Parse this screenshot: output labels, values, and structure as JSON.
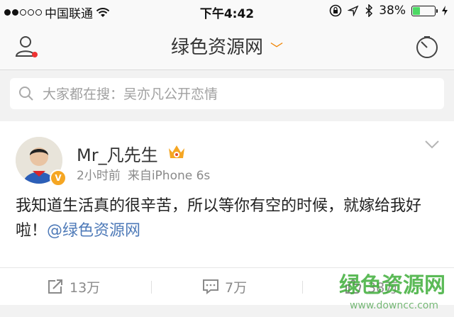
{
  "status_bar": {
    "carrier": "中国联通",
    "time": "下午4:42",
    "battery_percent": "38%",
    "battery_level": 0.38
  },
  "nav": {
    "title": "绿色资源网",
    "title_chevron": "﹀"
  },
  "search": {
    "placeholder": "大家都在搜：吴亦凡公开恋情"
  },
  "post": {
    "author": "Mr_凡先生",
    "time": "2小时前",
    "source": "来自iPhone 6s",
    "verified_badge": "V",
    "text": "我知道生活真的很辛苦，所以等你有空的时候，就嫁给我好啦！",
    "mention": "@绿色资源网"
  },
  "actions": {
    "repost_count": "13万",
    "comment_count": "7万",
    "like_count": "38万"
  },
  "watermark": {
    "text": "绿色资源网",
    "url": "www.downcc.com"
  },
  "colors": {
    "accent_orange": "#f08300",
    "link_blue": "#4e7ab8",
    "notification_red": "#e33",
    "battery_green": "#4cd964"
  }
}
